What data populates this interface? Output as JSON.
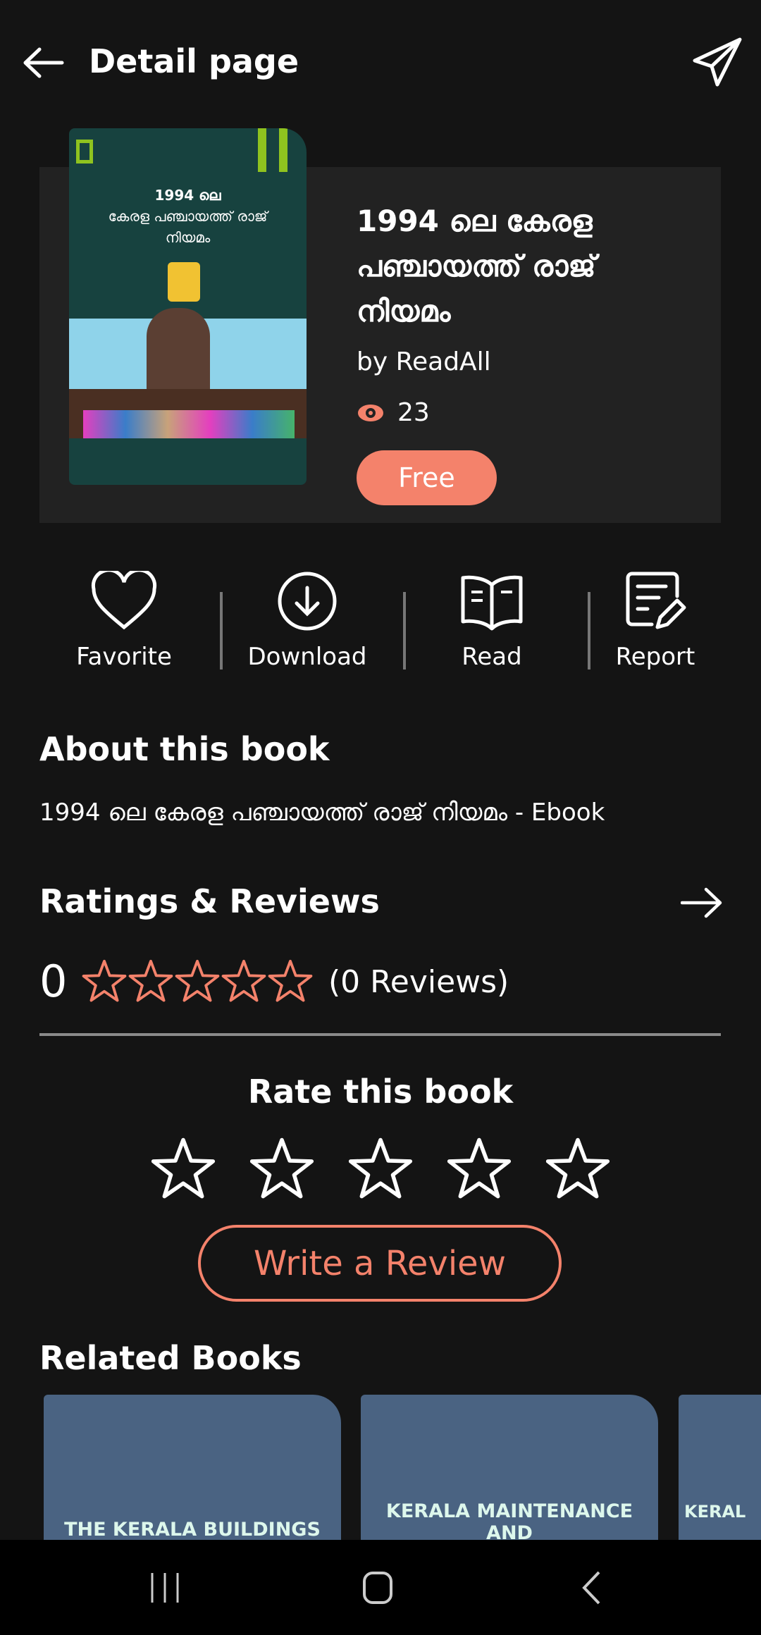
{
  "header": {
    "title": "Detail page",
    "back_icon": "arrow-left-icon",
    "share_icon": "send-icon"
  },
  "book": {
    "title": "1994 ലെ കേരള പഞ്ചായത്ത് രാജ് നിയമം",
    "author": "by ReadAll",
    "views": "23",
    "price": "Free",
    "cover": {
      "line1": "1994 ലെ",
      "line2": "കേരള പഞ്ചായത്ത് രാജ്",
      "line3": "നിയമം"
    }
  },
  "actions": [
    {
      "label": "Favorite",
      "icon": "heart-icon"
    },
    {
      "label": "Download",
      "icon": "download-icon"
    },
    {
      "label": "Read",
      "icon": "book-open-icon"
    },
    {
      "label": "Report",
      "icon": "report-icon"
    }
  ],
  "about": {
    "heading": "About this book",
    "description": "1994 ലെ കേരള പഞ്ചായത്ത് രാജ് നിയമം - Ebook"
  },
  "ratings": {
    "heading": "Ratings & Reviews",
    "average": "0",
    "stars_filled": 0,
    "reviews": "(0 Reviews)"
  },
  "rate": {
    "heading": "Rate this book",
    "write_review": "Write a Review"
  },
  "related": {
    "heading": "Related Books",
    "books": [
      {
        "title": "THE KERALA BUILDINGS"
      },
      {
        "title": "KERALA MAINTENANCE AND"
      },
      {
        "title": "KERAL"
      }
    ]
  },
  "colors": {
    "accent": "#f4826b",
    "background": "#141414",
    "panel": "#222222",
    "related_card": "#4a6382"
  }
}
